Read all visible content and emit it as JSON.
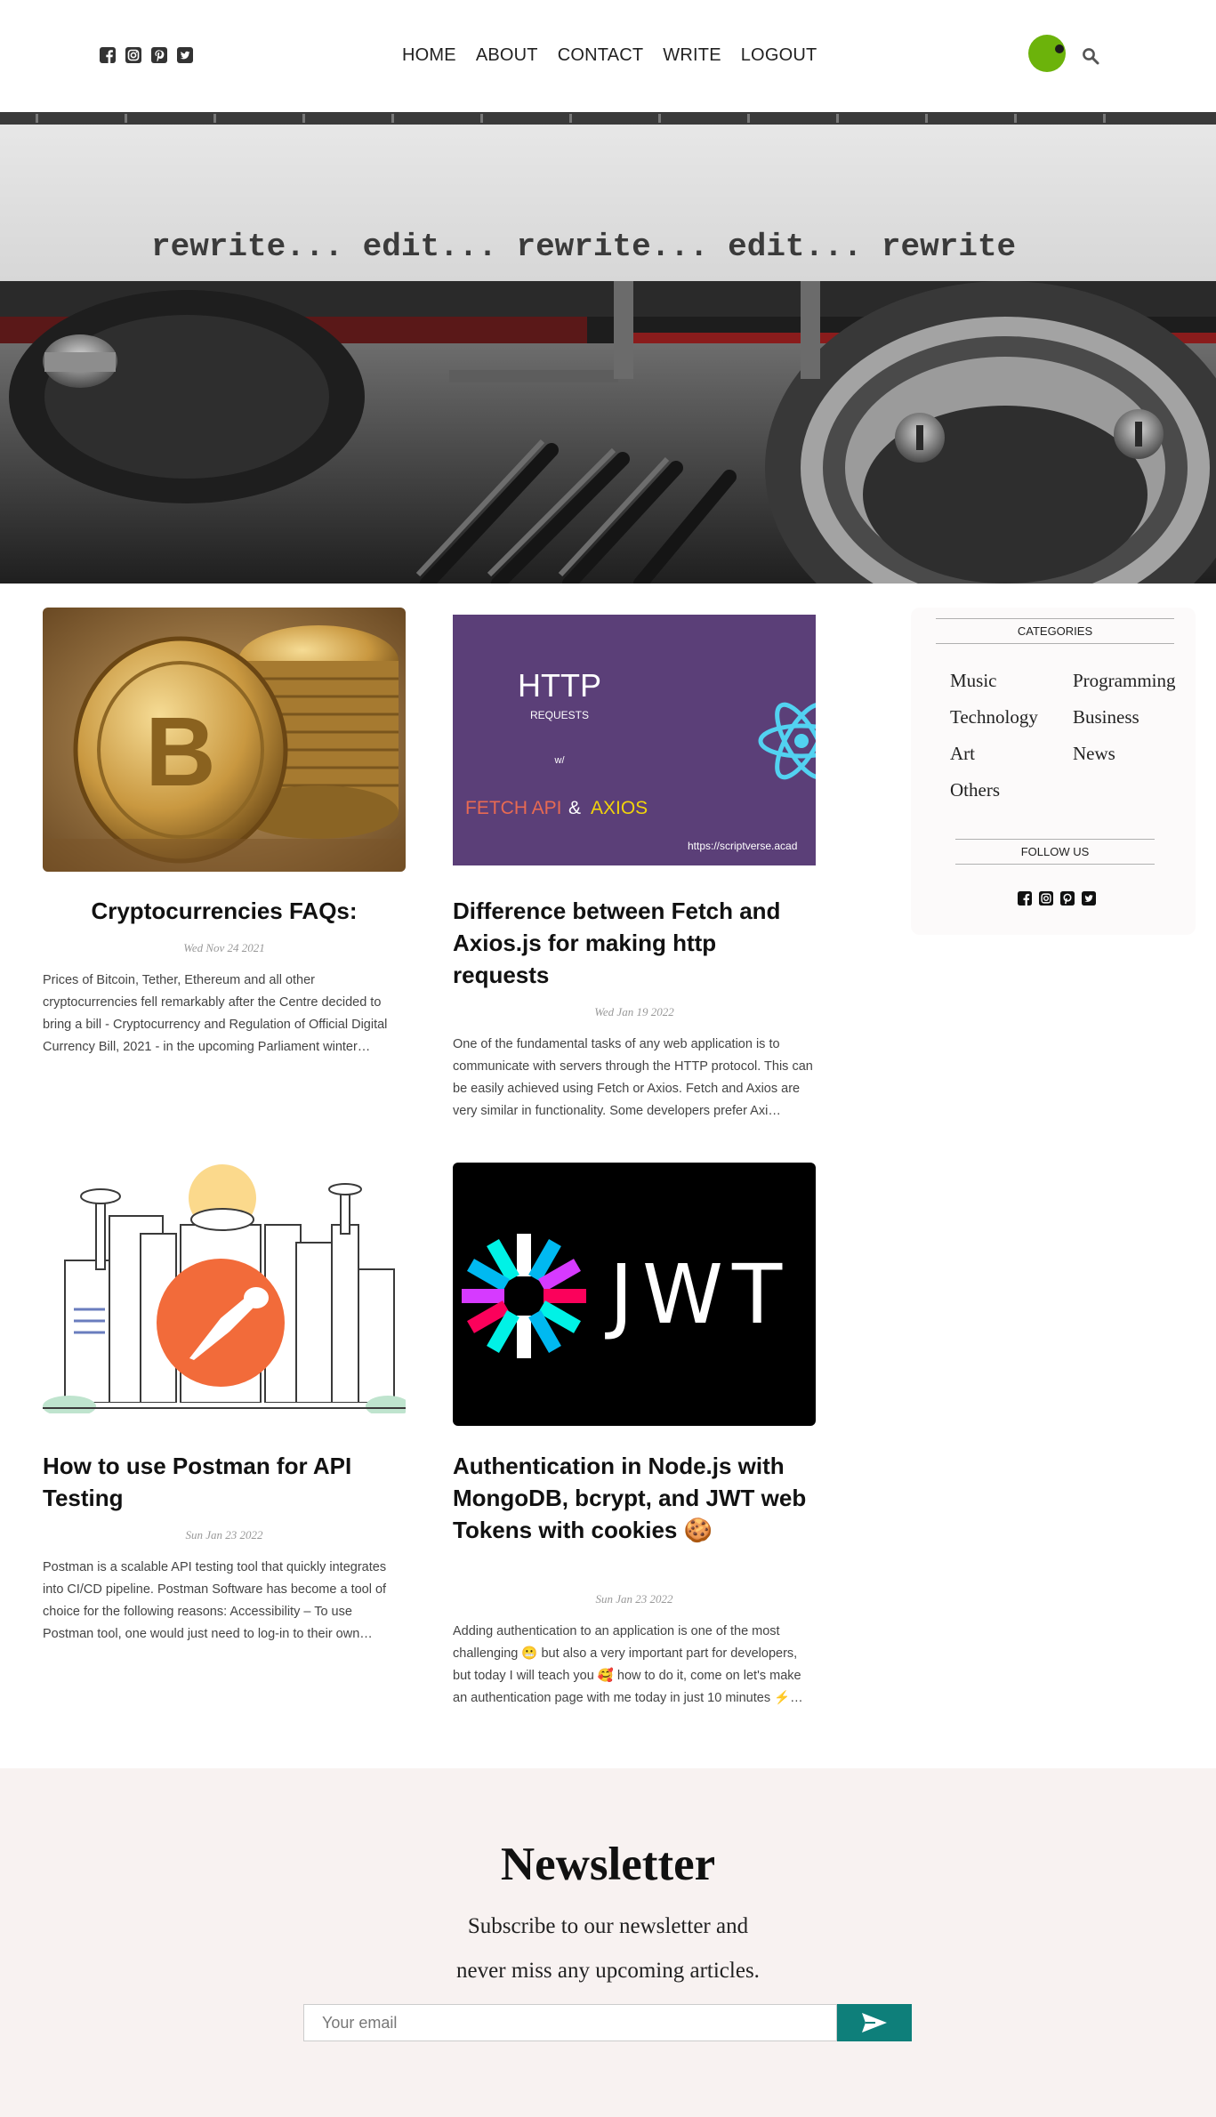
{
  "header": {
    "social_icons": [
      "facebook-square-icon",
      "instagram-square-icon",
      "pinterest-square-icon",
      "twitter-square-icon"
    ],
    "nav": {
      "home": "HOME",
      "about": "ABOUT",
      "contact": "CONTACT",
      "write": "WRITE",
      "logout": "LOGOUT"
    },
    "avatar_color": "#6cb30b"
  },
  "hero": {
    "typed_text": "rewrite... edit... rewrite... edit... rewrite"
  },
  "posts": [
    {
      "title": "Cryptocurrencies FAQs:",
      "date": "Wed Nov 24 2021",
      "desc": "Prices of Bitcoin, Tether, Ethereum and all other cryptocurrencies fell remarkably after the Centre decided to bring a bill - Cryptocurrency and Regulation of Official Digital Currency Bill, 2021 - in the upcoming Parliament winter…"
    },
    {
      "title": "Difference between Fetch and Axios.js for making http requests",
      "date": "Wed Jan 19 2022",
      "desc": "One of the fundamental tasks of any web application is to communicate with servers through the HTTP protocol. This can be easily achieved using Fetch or Axios. Fetch and Axios are very similar in functionality. Some developers prefer Axi…",
      "thumb": {
        "title": "HTTP",
        "sub": "REQUESTS",
        "w": "w/",
        "fetch": "FETCH API",
        "amp": "&",
        "axios": "AXIOS",
        "url": "https://scriptverse.acad"
      }
    },
    {
      "title": "How to use Postman for API Testing",
      "date": "Sun Jan 23 2022",
      "desc": "Postman is a scalable API testing tool that quickly integrates into CI/CD pipeline. Postman Software has become a tool of choice for the following reasons: Accessibility – To use Postman tool, one would just need to log-in to their own…"
    },
    {
      "title": "Authentication in Node.js with MongoDB, bcrypt, and JWT web Tokens with cookies 🍪",
      "date": "Sun Jan 23 2022",
      "desc": "Adding authentication to an application is one of the most challenging 😬 but also a very important part for developers, but today I will teach you 🥰 how to do it, come on let's make an authentication page with me today in just 10 minutes ⚡…",
      "thumb": {
        "text": "JWT"
      }
    }
  ],
  "sidebar": {
    "categories_title": "CATEGORIES",
    "categories": [
      "Music",
      "Programming",
      "Technology",
      "Business",
      "Art",
      "News",
      "Others"
    ],
    "follow_title": "FOLLOW US"
  },
  "newsletter": {
    "title": "Newsletter",
    "line1": "Subscribe to our newsletter and",
    "line2": "never miss any upcoming articles.",
    "placeholder": "Your email",
    "button_color": "#0e7f7a"
  }
}
